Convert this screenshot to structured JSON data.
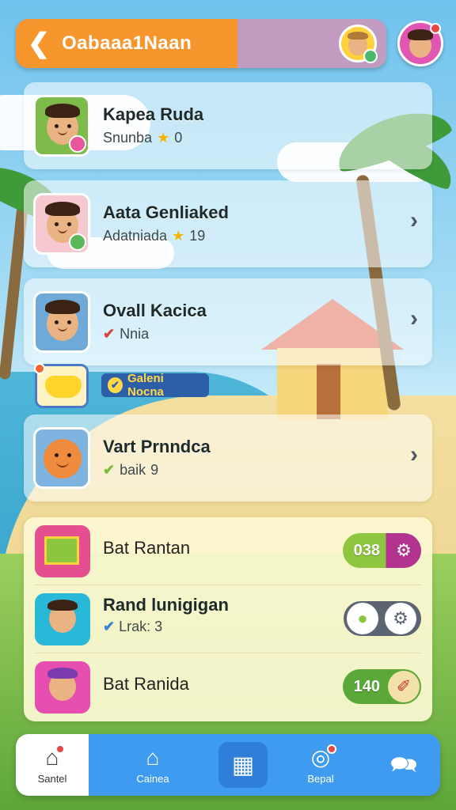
{
  "header": {
    "title": "Oabaaa1Naan",
    "back_icon": "back-arrow-icon"
  },
  "friends": [
    {
      "name": "Kapea Ruda",
      "status": "Snunba",
      "badge": "star",
      "count": "0"
    },
    {
      "name": "Aata Genliaked",
      "status": "Adatniada",
      "badge": "star",
      "count": "19"
    },
    {
      "name": "Ovall Kacica",
      "status": "Nnia",
      "badge": "check",
      "count": ""
    },
    {
      "name": "Vart Prnndca",
      "status": "baik",
      "badge": "check",
      "count": "9"
    }
  ],
  "banner": {
    "label": "Galeni Nocna"
  },
  "settings": [
    {
      "title": "Bat Rantan",
      "value": "038",
      "control": "gear-toggle"
    },
    {
      "title": "Rand lunigigan",
      "status": "Lrak:",
      "count": "3",
      "control": "gear-toggle"
    },
    {
      "title": "Bat Ranida",
      "value": "140",
      "control": "brush-toggle"
    }
  ],
  "nav": {
    "items": [
      {
        "label": "Santel",
        "icon": "home-icon"
      },
      {
        "label": "Cainea",
        "icon": "house-icon"
      },
      {
        "label": "",
        "icon": "grid-icon"
      },
      {
        "label": "Bepal",
        "icon": "target-icon"
      },
      {
        "label": "",
        "icon": "chat-icon"
      }
    ]
  },
  "colors": {
    "header_orange": "#f7962c",
    "nav_blue": "#3f9bf0",
    "toggle_green": "#8fc63f",
    "toggle_purple": "#b3348f"
  }
}
